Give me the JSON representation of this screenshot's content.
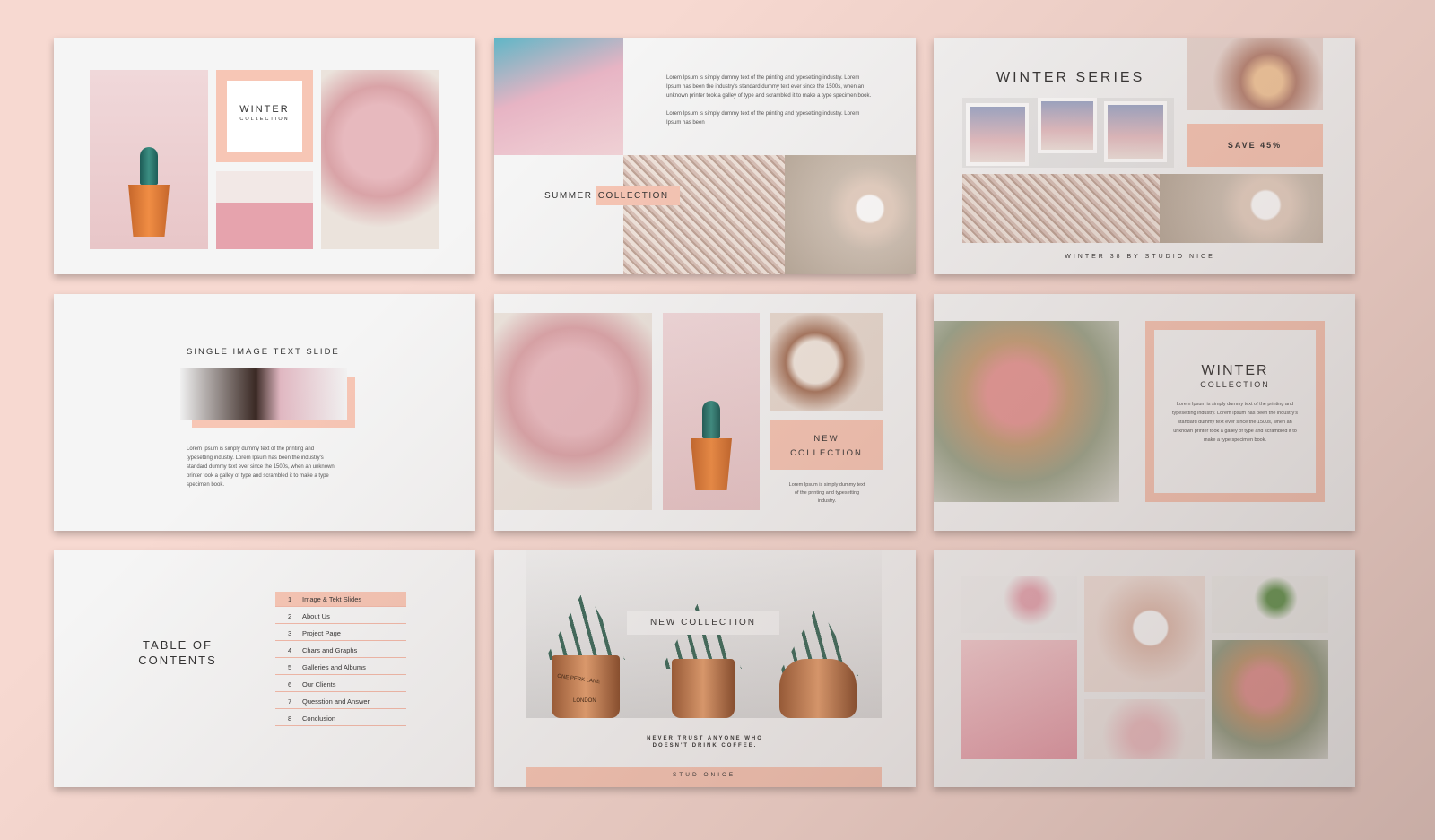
{
  "slide1": {
    "title": "WINTER",
    "subtitle": "COLLECTION"
  },
  "slide2": {
    "paragraph1": "Lorem Ipsum is simply dummy text of the printing and typesetting industry. Lorem Ipsum has been the industry's standard dummy text ever since the 1500s, when an unknown printer took a galley of type and scrambled it to make a type specimen book.",
    "paragraph2": "Lorem Ipsum is simply dummy text of the printing and typesetting industry. Lorem Ipsum has been",
    "label_a": "SUMMER ",
    "label_b": "COLLECTION"
  },
  "slide3": {
    "title": "WINTER SERIES",
    "badge": "SAVE 45%",
    "footer": "WINTER 38 BY STUDIO NICE"
  },
  "slide4": {
    "title": "SINGLE IMAGE TEXT SLIDE",
    "paragraph": "Lorem Ipsum is simply dummy text of the printing and typesetting industry. Lorem Ipsum has been the industry's standard dummy text ever since the 1500s, when an unknown printer took a galley of type and scrambled it to make a type specimen book."
  },
  "slide5": {
    "title_line1": "NEW",
    "title_line2": "COLLECTION",
    "caption": "Lorem Ipsum is simply dummy text of the printing and typesetting industry."
  },
  "slide6": {
    "title": "WINTER",
    "subtitle": "COLLECTION",
    "paragraph": "Lorem Ipsum is simply dummy text of the printing and typesetting industry. Lorem Ipsum has been the industry's standard dummy text ever since the 1500s, when an unknown printer took a galley of type and scrambled it to make a type specimen book."
  },
  "slide7": {
    "title_line1": "TABLE OF",
    "title_line2": "CONTENTS",
    "items": [
      {
        "num": "1",
        "label": "Image & Tekt Slides"
      },
      {
        "num": "2",
        "label": "About Us"
      },
      {
        "num": "3",
        "label": "Project Page"
      },
      {
        "num": "4",
        "label": "Chars and Graphs"
      },
      {
        "num": "5",
        "label": "Galleries and Albums"
      },
      {
        "num": "6",
        "label": "Our Clients"
      },
      {
        "num": "7",
        "label": "Quesstion and Answer"
      },
      {
        "num": "8",
        "label": "Conclusion"
      }
    ]
  },
  "slide8": {
    "title": "NEW COLLECTION",
    "pot_text_1": "ONE PERK LANE",
    "pot_text_2": "LONDON",
    "quote_line1": "NEVER TRUST ANYONE WHO",
    "quote_line2": "DOESN'T DRINK COFFEE.",
    "footer": "STUDIONICE"
  },
  "colors": {
    "background": "#f7d9d1",
    "accent": "#f7c6b5",
    "slide": "#f5f5f5",
    "text": "#333333"
  }
}
